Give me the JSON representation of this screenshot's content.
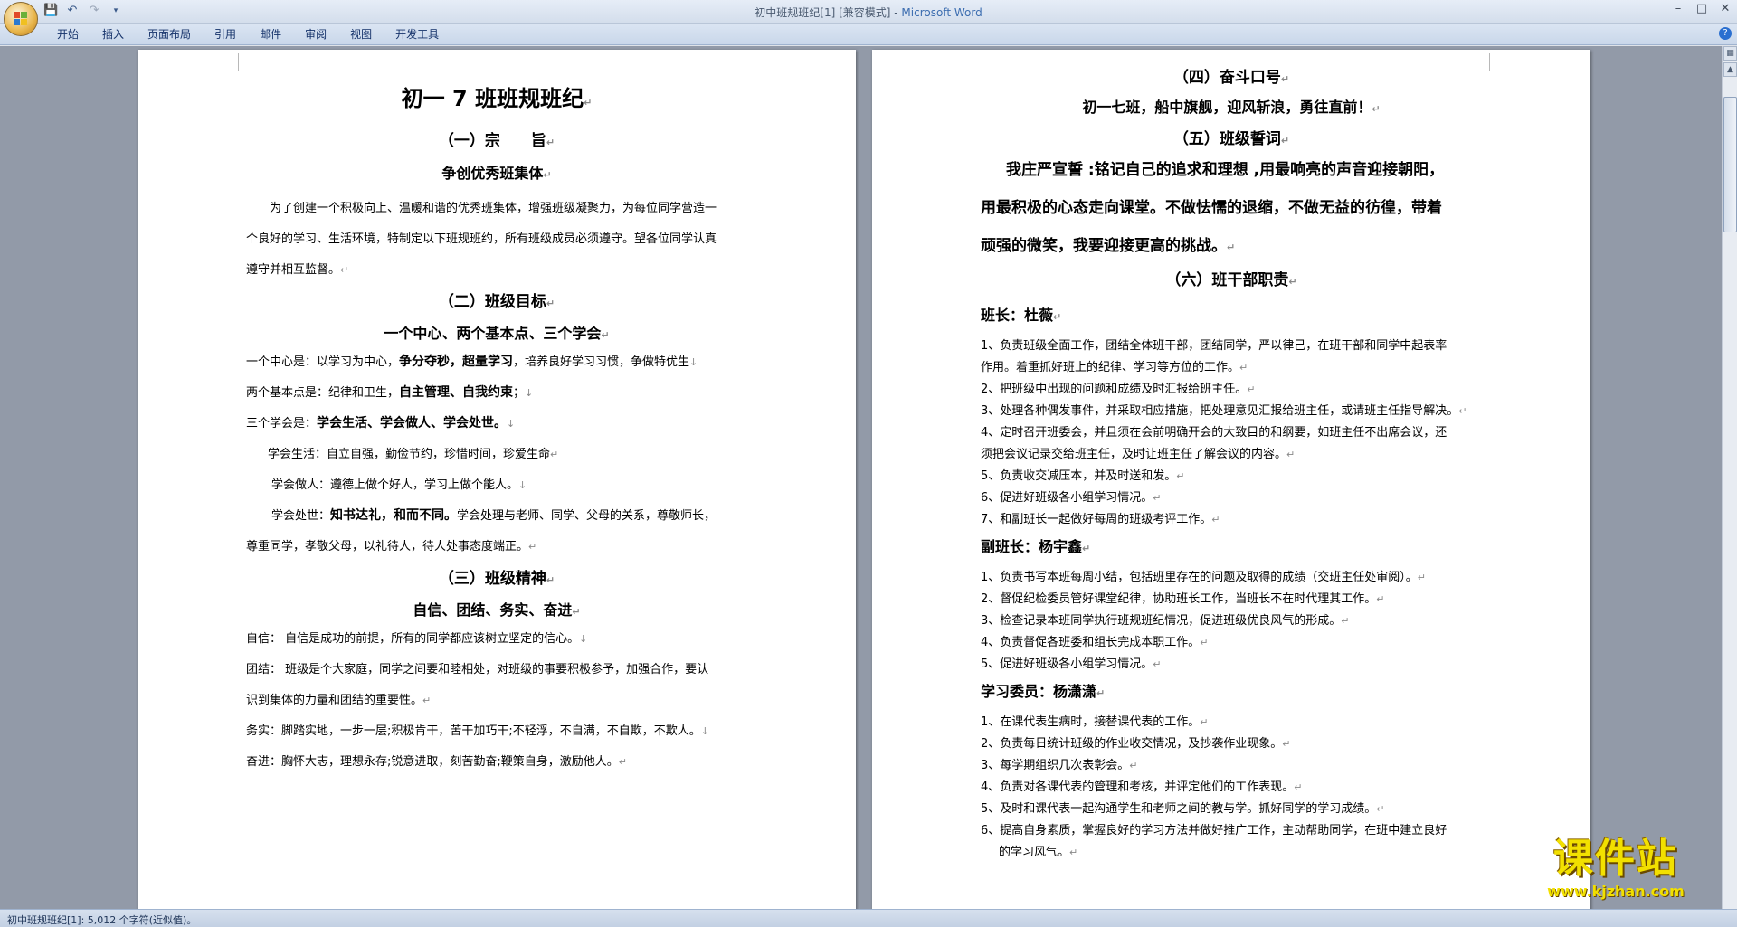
{
  "window": {
    "title": "初中班规班纪[1] [兼容模式] - ",
    "app_name": "Microsoft Word",
    "controls": [
      "–",
      "□",
      "✕"
    ]
  },
  "qat": {
    "icons": [
      "save-icon",
      "undo-icon",
      "redo-icon",
      "customize-icon"
    ]
  },
  "ribbon": {
    "tabs": [
      "开始",
      "插入",
      "页面布局",
      "引用",
      "邮件",
      "审阅",
      "视图",
      "开发工具"
    ],
    "help_label": "?"
  },
  "left_page": {
    "title": "初一 7 班班规班纪",
    "sec1": "（一）宗　　旨",
    "sec1_sub": "争创优秀班集体",
    "sec1_p1": "为了创建一个积极向上、温暖和谐的优秀班集体，增强班级凝聚力，为每位同学营造一",
    "sec1_p2": "个良好的学习、生活环境，特制定以下班规班约，所有班级成员必须遵守。望各位同学认真",
    "sec1_p3": "遵守并相互监督。",
    "sec2": "（二）班级目标",
    "sec2_sub": "一个中心、两个基本点、三个学会",
    "goal1_a": "一个中心是：以学习为中心，",
    "goal1_b": "争分夺秒，超量学习",
    "goal1_c": "，培养良好学习习惯，争做特优生",
    "goal2_a": "两个基本点是：纪律和卫生，",
    "goal2_b": "自主管理、自我约束",
    "goal2_c": "；",
    "goal3_a": "三个学会是：",
    "goal3_b": "学会生活、学会做人、学会处世。",
    "learn1": "学会生活：自立自强，勤俭节约，珍惜时间，珍爱生命",
    "learn2": "学会做人：遵德上做个好人，学习上做个能人。",
    "learn3_a": "学会处世：",
    "learn3_b": "知书达礼，和而不同。",
    "learn3_c": "学会处理与老师、同学、父母的关系，尊敬师长，",
    "learn3_d": "尊重同学，孝敬父母，以礼待人，待人处事态度端正。",
    "sec3": "（三）班级精神",
    "sec3_sub": "自信、团结、务实、奋进",
    "sp1": "自信：  自信是成功的前提，所有的同学都应该树立坚定的信心。",
    "sp2a": "团结：  班级是个大家庭，同学之间要和睦相处，对班级的事要积极参予，加强合作，要认",
    "sp2b": "识到集体的力量和团结的重要性。",
    "sp3": "务实：脚踏实地，一步一层;积极肯干，苦干加巧干;不轻浮，不自满，不自欺，不欺人。",
    "sp4": "奋进：胸怀大志，理想永存;锐意进取，刻苦勤奋;鞭策自身，激励他人。"
  },
  "right_page": {
    "sec4": "（四）奋斗口号",
    "slogan": "初一七班，船中旗舰，迎风斩浪，勇往直前！",
    "sec5": "（五）班级誓词",
    "oath1": "我庄严宣誓 :铭记自己的追求和理想 ,用最响亮的声音迎接朝阳，",
    "oath2": "用最积极的心态走向课堂。不做怯懦的退缩，不做无益的彷徨，带着",
    "oath3": "顽强的微笑，我要迎接更高的挑战。",
    "sec6": "（六）班干部职责",
    "role1": "班长：杜薇",
    "r1_1a": "1、负责班级全面工作，团结全体班干部，团结同学，严以律己，在班干部和同学中起表率",
    "r1_1b": "作用。着重抓好班上的纪律、学习等方位的工作。",
    "r1_2": "2、把班级中出现的问题和成绩及时汇报给班主任。",
    "r1_3": "3、处理各种偶发事件，并采取相应措施，把处理意见汇报给班主任，或请班主任指导解决。",
    "r1_4a": "4、定时召开班委会，并且须在会前明确开会的大致目的和纲要，如班主任不出席会议，还",
    "r1_4b": "须把会议记录交给班主任，及时让班主任了解会议的内容。",
    "r1_5": "5、负责收交减压本，并及时送和发。",
    "r1_6": "6、促进好班级各小组学习情况。",
    "r1_7": "7、和副班长一起做好每周的班级考评工作。",
    "role2": "副班长：杨宇鑫",
    "r2_1": "1、负责书写本班每周小结，包括班里存在的问题及取得的成绩（交班主任处审阅）。",
    "r2_2": "2、督促纪检委员管好课堂纪律，协助班长工作，当班长不在时代理其工作。",
    "r2_3": "3、检查记录本班同学执行班规班纪情况，促进班级优良风气的形成。",
    "r2_4": "4、负责督促各班委和组长完成本职工作。",
    "r2_5": "5、促进好班级各小组学习情况。",
    "role3": "学习委员：杨潇潇",
    "r3_1": "1、在课代表生病时，接替课代表的工作。",
    "r3_2": "2、负责每日统计班级的作业收交情况，及抄袭作业现象。",
    "r3_3": "3、每学期组织几次表彰会。",
    "r3_4": "4、负责对各课代表的管理和考核，并评定他们的工作表现。",
    "r3_5": "5、及时和课代表一起沟通学生和老师之间的教与学。抓好同学的学习成绩。",
    "r3_6a": "6、提高自身素质，掌握良好的学习方法并做好推广工作，主动帮助同学，在班中建立良好",
    "r3_6b": "的学习风气。"
  },
  "marks": {
    "para": "↵",
    "line": "↓"
  },
  "status": {
    "text": "初中班规班纪[1]: 5,012 个字符(近似值)。"
  },
  "watermark": {
    "line1": "课件站",
    "line2": "www.kjzhan.com"
  },
  "colors": {
    "ribbon": "#c9d7ea",
    "workspace": "#929aa8",
    "app_name": "#3c6db0",
    "watermark": "#f2e000"
  }
}
